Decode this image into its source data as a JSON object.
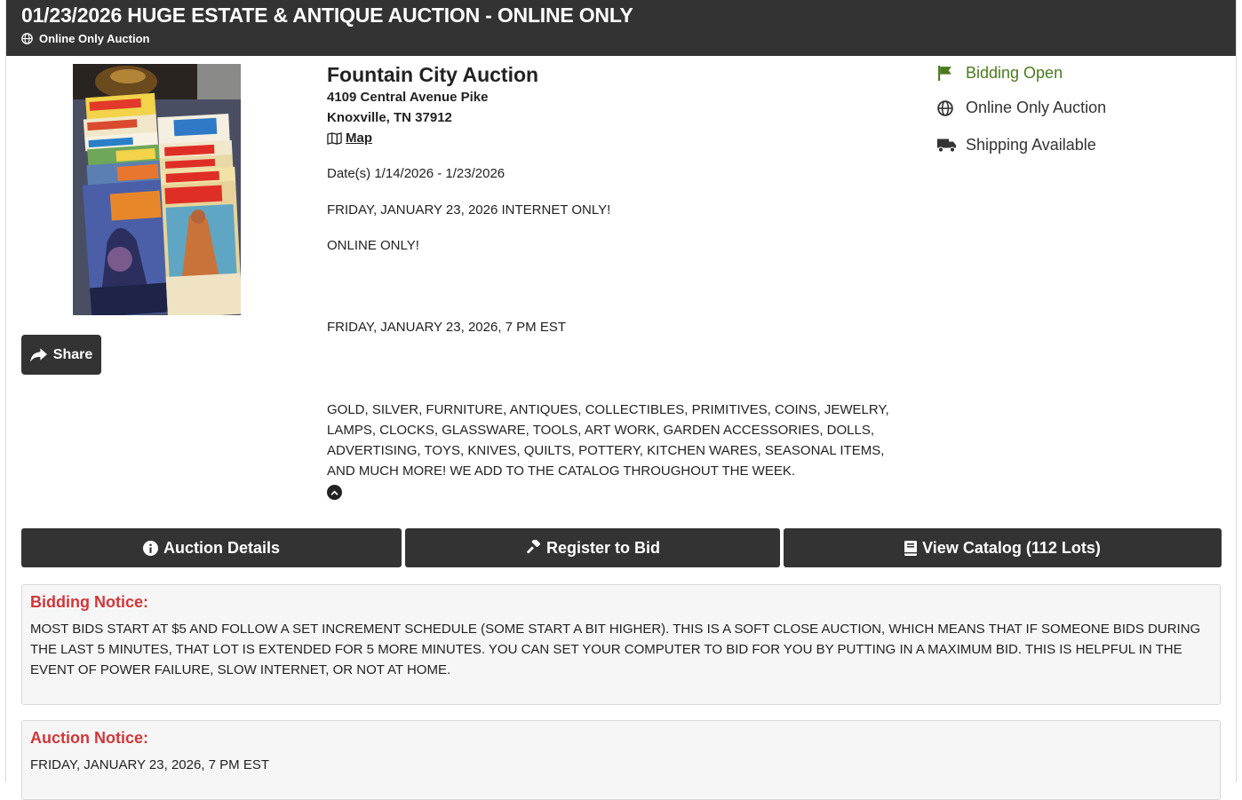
{
  "header": {
    "title": "01/23/2026 HUGE ESTATE & ANTIQUE AUCTION - ONLINE ONLY",
    "subtitle": "Online Only Auction"
  },
  "share_label": "Share",
  "auctioneer": {
    "name": "Fountain City Auction",
    "address_line1": "4109 Central Avenue Pike",
    "address_line2": "Knoxville, TN 37912",
    "map_label": "Map"
  },
  "details": {
    "dates": "Date(s) 1/14/2026 - 1/23/2026",
    "line1": "FRIDAY, JANUARY 23, 2026 INTERNET ONLY!",
    "line2": "ONLINE ONLY!",
    "line3": "FRIDAY, JANUARY 23, 2026, 7 PM EST",
    "description": "GOLD, SILVER, FURNITURE, ANTIQUES, COLLECTIBLES, PRIMITIVES, COINS, JEWELRY, LAMPS, CLOCKS, GLASSWARE, TOOLS, ART WORK, GARDEN ACCESSORIES, DOLLS, ADVERTISING, TOYS, KNIVES, QUILTS, POTTERY, KITCHEN WARES, SEASONAL ITEMS, AND MUCH MORE! WE ADD TO THE CATALOG THROUGHOUT THE WEEK."
  },
  "status": {
    "bidding": "Bidding Open",
    "type": "Online Only Auction",
    "shipping": "Shipping Available",
    "bidding_color": "#4b7a1f"
  },
  "actions": {
    "details": "Auction Details",
    "register": "Register to Bid",
    "catalog": "View Catalog (112 Lots)"
  },
  "notices": {
    "bidding_title": "Bidding Notice:",
    "bidding_body": "MOST BIDS START AT $5 AND FOLLOW A SET INCREMENT SCHEDULE (SOME START A BIT HIGHER). THIS IS A SOFT CLOSE AUCTION, WHICH MEANS THAT IF SOMEONE BIDS DURING THE LAST 5 MINUTES, THAT LOT IS EXTENDED FOR 5 MORE MINUTES. YOU CAN SET YOUR COMPUTER TO BID FOR YOU BY PUTTING IN A MAXIMUM BID. THIS IS HELPFUL IN THE EVENT OF POWER FAILURE, SLOW INTERNET, OR NOT AT HOME.",
    "auction_title": "Auction Notice:",
    "auction_body": "FRIDAY, JANUARY 23, 2026, 7 PM EST"
  },
  "image": {
    "comic_titles": [
      "LITTLE LULU",
      "LITTLE DOT",
      "TARZAN",
      "KORAK SON OF TARZAN"
    ]
  },
  "colors": {
    "header_bg": "#333333",
    "notice_title": "#d0373a"
  }
}
